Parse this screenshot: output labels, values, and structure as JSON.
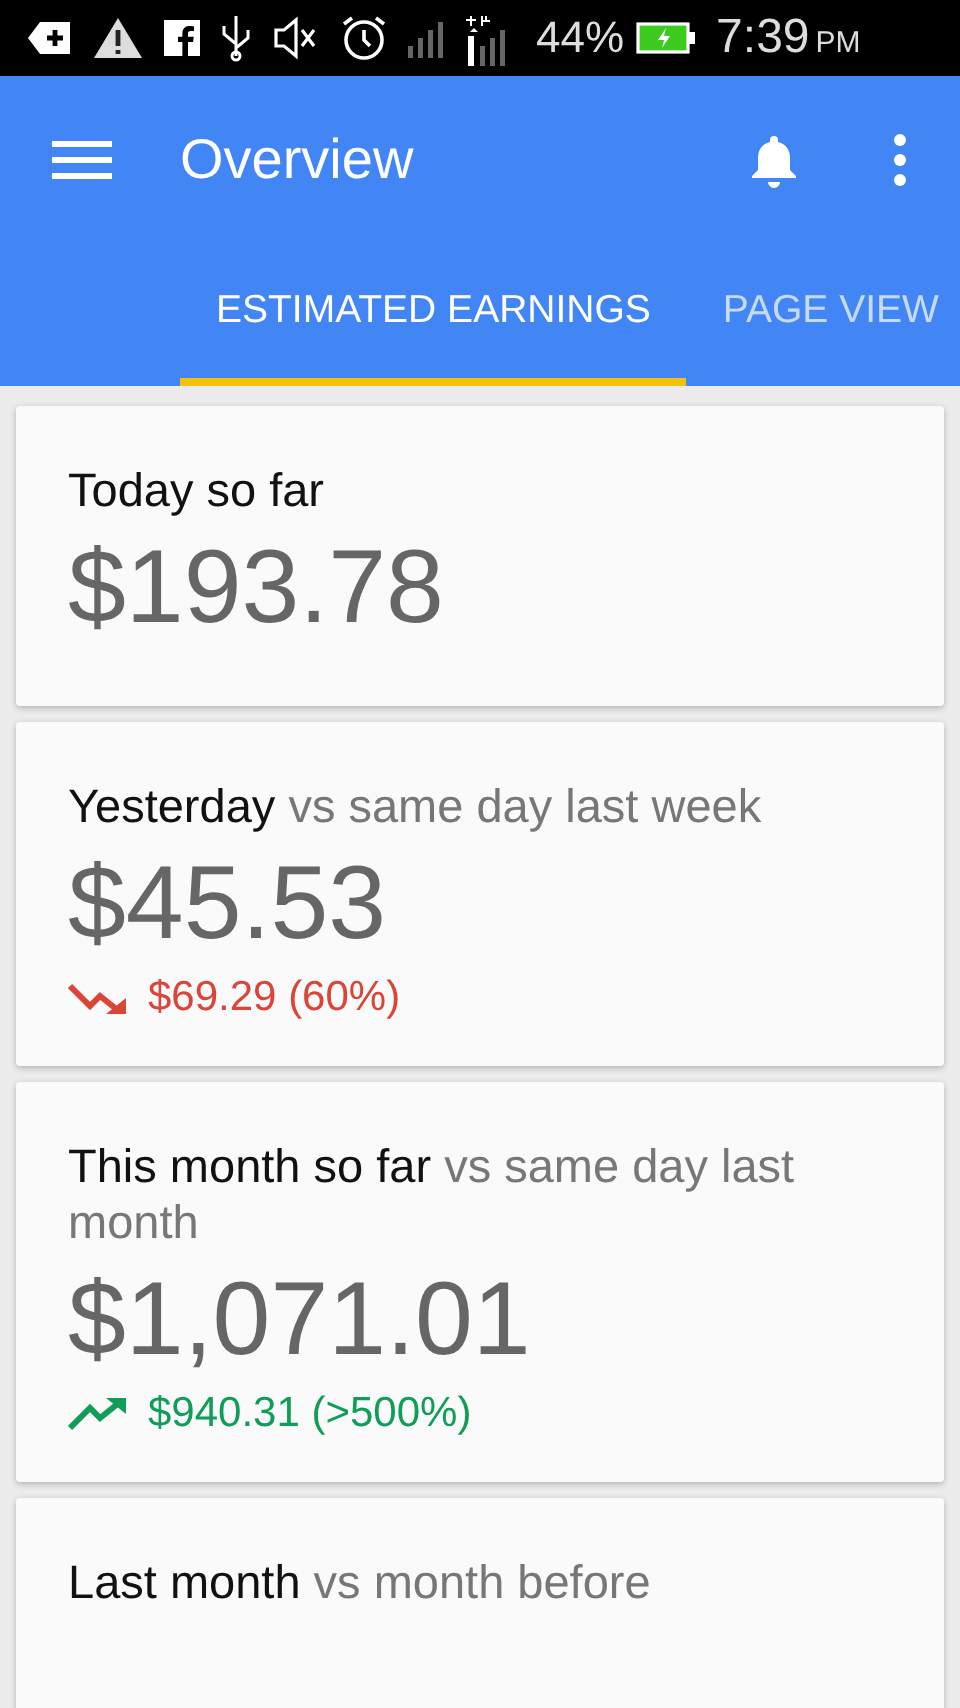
{
  "status_bar": {
    "battery": "44%",
    "time": "7:39",
    "time_suffix": "PM"
  },
  "app_bar": {
    "title": "Overview"
  },
  "tabs": [
    {
      "label": "ESTIMATED EARNINGS",
      "selected": true
    },
    {
      "label": "PAGE VIEW",
      "selected": false
    }
  ],
  "cards": [
    {
      "title": "Today so far",
      "amount": "$193.78"
    },
    {
      "title": "Yesterday",
      "comparison": "vs same day last week",
      "amount": "$45.53",
      "change": {
        "kind": "down",
        "text": "$69.29 (60%)"
      }
    },
    {
      "title": "This month so far",
      "comparison": "vs same day last month",
      "amount": "$1,071.01",
      "change": {
        "kind": "up",
        "text": "$940.31 (>500%)"
      }
    },
    {
      "title": "Last month",
      "comparison": "vs month before"
    }
  ]
}
